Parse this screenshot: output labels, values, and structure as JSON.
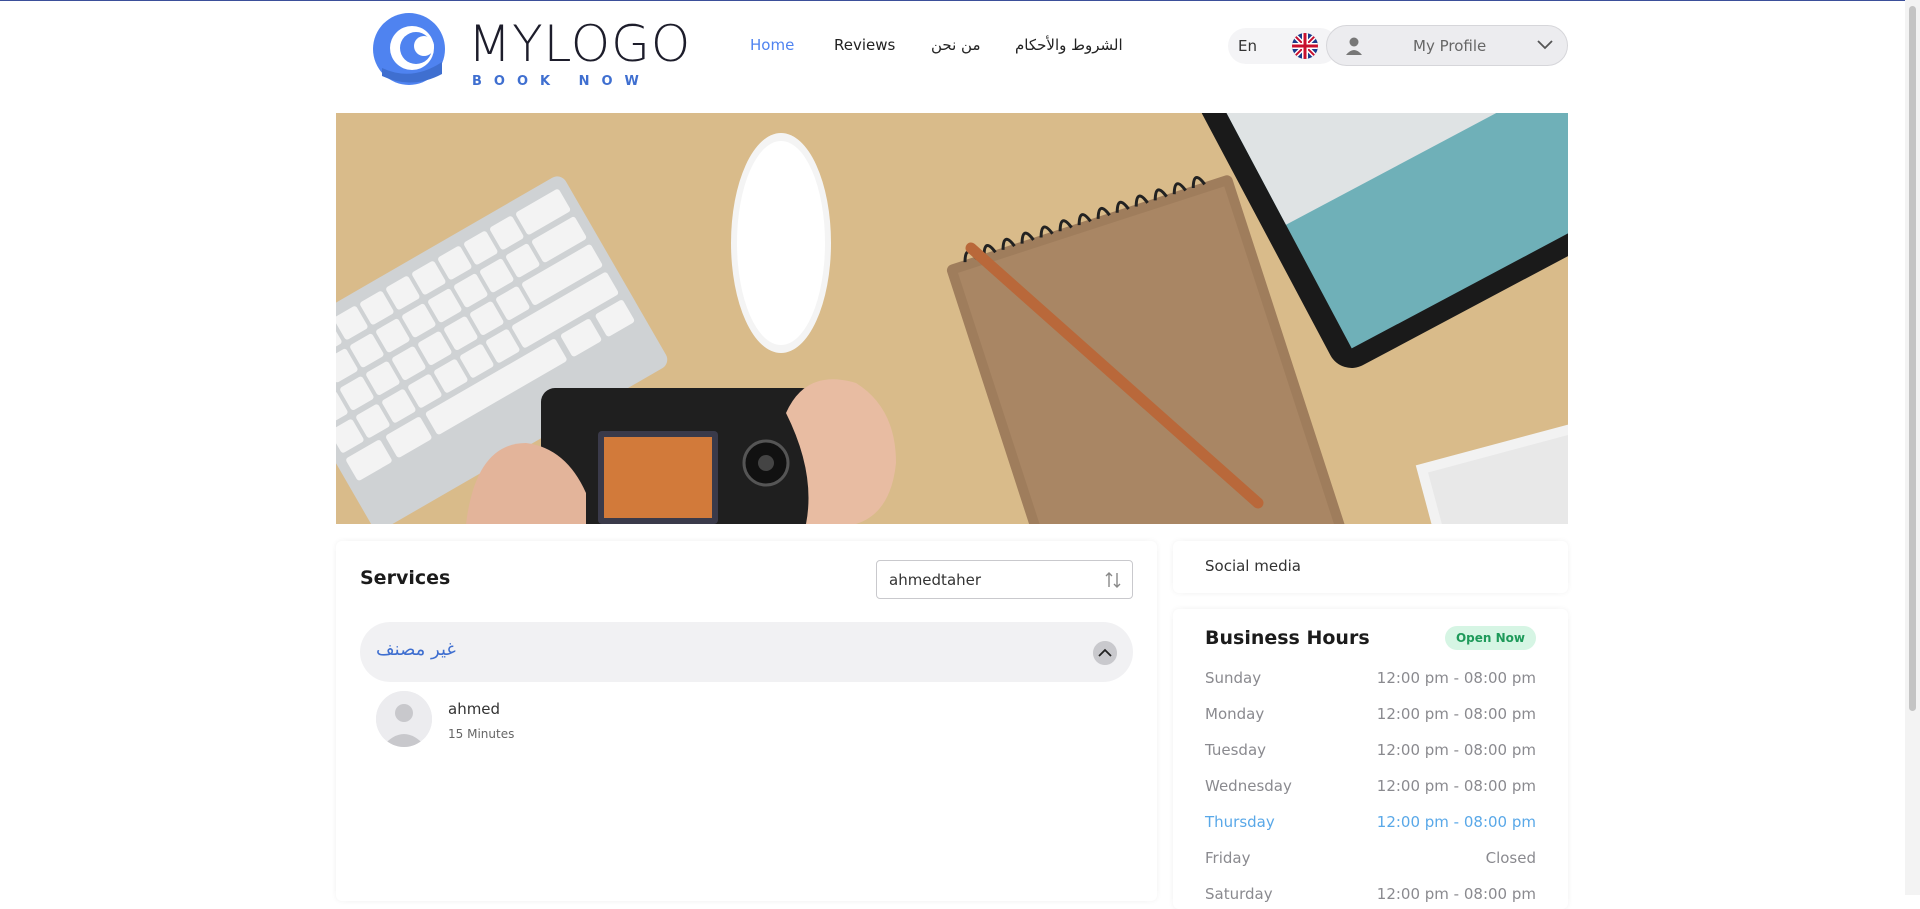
{
  "header": {
    "logo_text": "MYLOGO",
    "logo_sub": "BOOK NOW",
    "nav": [
      {
        "label": "Home",
        "active": true
      },
      {
        "label": "Reviews",
        "active": false
      },
      {
        "label": "من نحن",
        "active": false
      },
      {
        "label": "الشروط والأحكام",
        "active": false
      }
    ],
    "language": "En",
    "profile_label": "My Profile"
  },
  "services": {
    "title": "Services",
    "search_value": "ahmedtaher",
    "category": "غير مصنف",
    "items": [
      {
        "name": "ahmed",
        "duration": "15 Minutes"
      }
    ]
  },
  "social": {
    "title": "Social media"
  },
  "hours": {
    "title": "Business Hours",
    "status": "Open Now",
    "days": [
      {
        "day": "Sunday",
        "time": "12:00 pm - 08:00 pm",
        "today": false
      },
      {
        "day": "Monday",
        "time": "12:00 pm - 08:00 pm",
        "today": false
      },
      {
        "day": "Tuesday",
        "time": "12:00 pm - 08:00 pm",
        "today": false
      },
      {
        "day": "Wednesday",
        "time": "12:00 pm - 08:00 pm",
        "today": false
      },
      {
        "day": "Thursday",
        "time": "12:00 pm - 08:00 pm",
        "today": true
      },
      {
        "day": "Friday",
        "time": "Closed",
        "today": false
      },
      {
        "day": "Saturday",
        "time": "12:00 pm - 08:00 pm",
        "today": false
      }
    ]
  },
  "colors": {
    "accent": "#4f83f0",
    "today": "#59a8e8",
    "open_badge": "#1e9a5a"
  }
}
